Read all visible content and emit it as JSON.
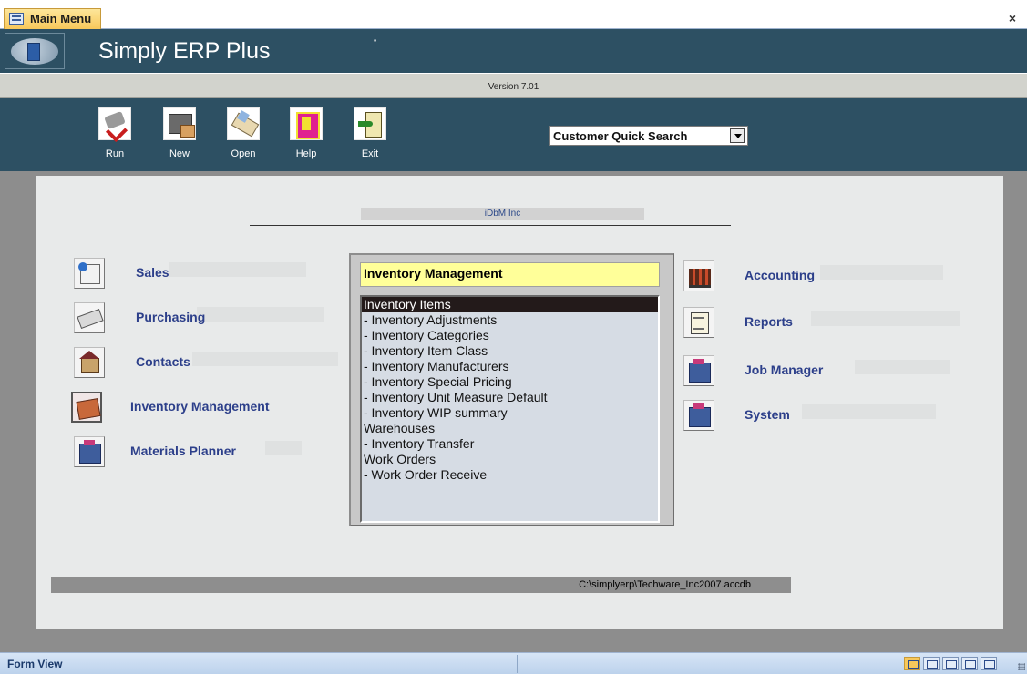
{
  "tab": {
    "title": "Main Menu",
    "close_label": "×"
  },
  "header": {
    "title": "Simply ERP Plus",
    "mark": "\""
  },
  "version": "Version 7.01",
  "toolbar": {
    "buttons": [
      {
        "label": "Run",
        "icon": "run-icon"
      },
      {
        "label": "New",
        "icon": "new-icon"
      },
      {
        "label": "Open",
        "icon": "open-icon"
      },
      {
        "label": "Help",
        "icon": "help-icon"
      },
      {
        "label": "Exit",
        "icon": "exit-icon"
      }
    ]
  },
  "quick_search": {
    "value": "Customer Quick Search"
  },
  "company": "iDbM Inc",
  "left_menu": [
    {
      "label": "Sales",
      "icon": "sales-icon"
    },
    {
      "label": "Purchasing",
      "icon": "purchasing-icon"
    },
    {
      "label": "Contacts",
      "icon": "contacts-icon"
    },
    {
      "label": "Inventory Management",
      "icon": "inventory-icon",
      "active": true
    },
    {
      "label": "Materials Planner",
      "icon": "materials-icon"
    }
  ],
  "right_menu": [
    {
      "label": "Accounting",
      "icon": "accounting-icon"
    },
    {
      "label": "Reports",
      "icon": "reports-icon"
    },
    {
      "label": "Job Manager",
      "icon": "job-manager-icon"
    },
    {
      "label": "System",
      "icon": "system-icon"
    }
  ],
  "list_panel": {
    "title": "Inventory Management",
    "items": [
      "Inventory Items",
      " - Inventory Adjustments",
      " - Inventory Categories",
      " - Inventory Item Class",
      " - Inventory Manufacturers",
      " - Inventory Special Pricing",
      " - Inventory Unit Measure Default",
      " - Inventory WIP summary",
      "Warehouses",
      " - Inventory Transfer",
      "Work Orders",
      " - Work Order Receive"
    ],
    "selected_index": 0
  },
  "db_path": "C:\\simplyerp\\Techware_Inc2007.accdb",
  "statusbar": {
    "text": "Form View"
  },
  "colors": {
    "header": "#2d5063",
    "panel": "#e8eaea",
    "title_highlight": "#ffff99",
    "label_blue": "#2c3f8a"
  }
}
